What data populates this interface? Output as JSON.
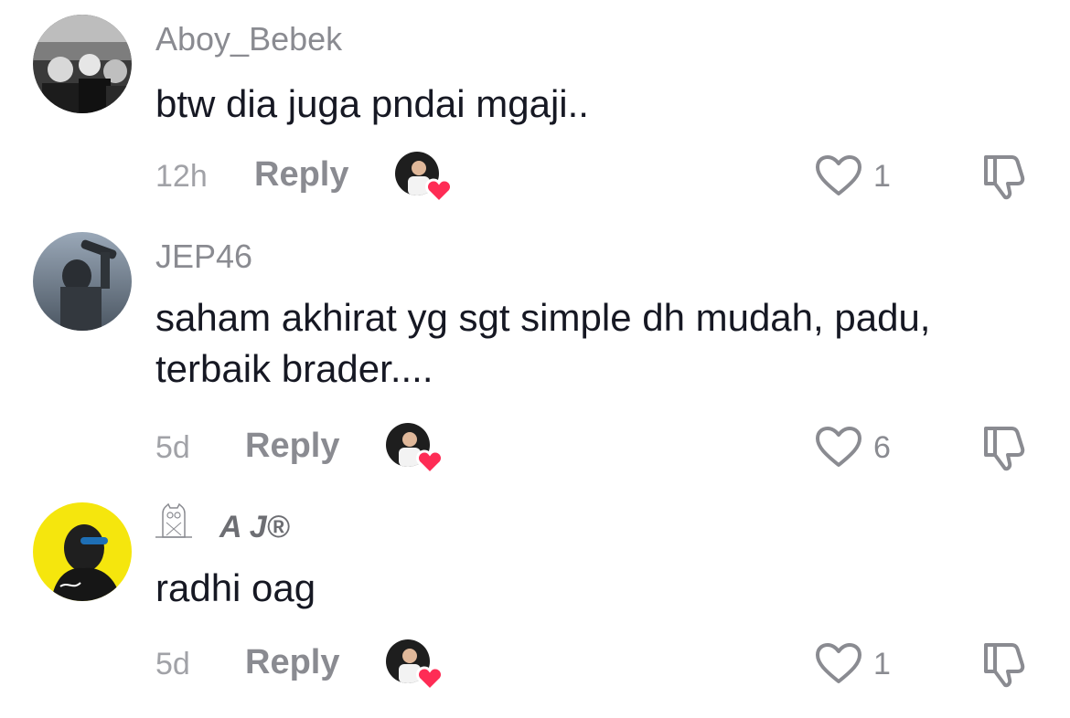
{
  "comments": [
    {
      "username": "Aboy_Bebek",
      "text": "btw dia juga pndai mgaji..",
      "time": "12h",
      "reply_label": "Reply",
      "likes": "1",
      "avatar_icon": "bw-photo-avatar"
    },
    {
      "username": "JEP46",
      "text": "saham akhirat yg sgt simple dh mudah, padu, terbaik brader....",
      "time": "5d",
      "reply_label": "Reply",
      "likes": "6",
      "avatar_icon": "pilot-photo-avatar"
    },
    {
      "username": "A J®",
      "text": "radhi oag",
      "time": "5d",
      "reply_label": "Reply",
      "likes": "1",
      "avatar_icon": "yellow-portrait-avatar",
      "badge_icon": "owl-icon"
    }
  ],
  "colors": {
    "heart_badge": "#fe2c55",
    "muted_text": "#8a8b91",
    "body_text": "#161823"
  }
}
